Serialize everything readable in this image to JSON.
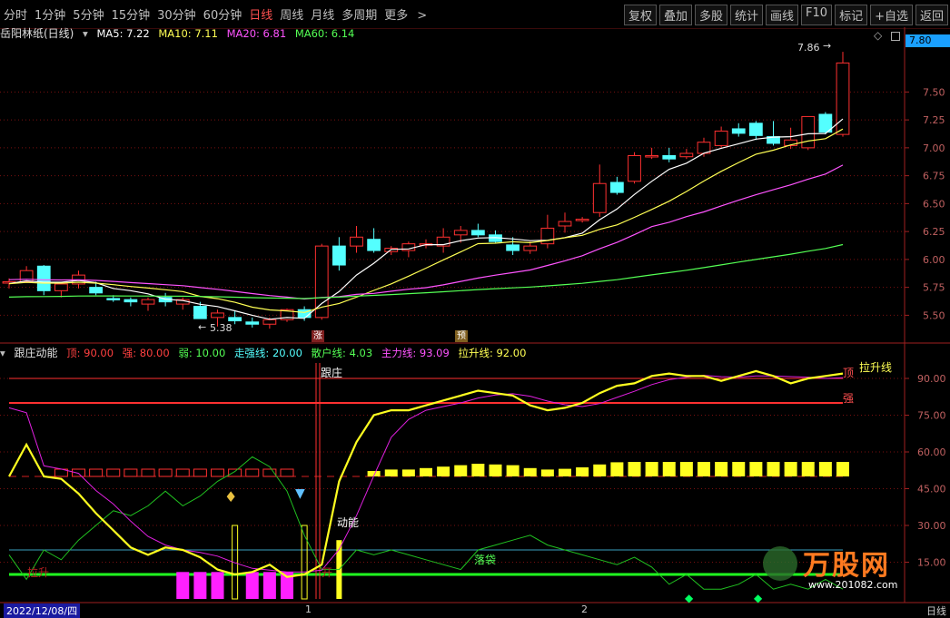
{
  "toolbar": {
    "periods": [
      "分时",
      "1分钟",
      "5分钟",
      "15分钟",
      "30分钟",
      "60分钟",
      "日线",
      "周线",
      "月线",
      "多周期",
      "更多"
    ],
    "active_period": "日线",
    "more_icon": "chevron-right-icon",
    "buttons": [
      "复权",
      "叠加",
      "多股",
      "统计",
      "画线",
      "F10",
      "标记",
      "+自选",
      "返回"
    ]
  },
  "main_panel": {
    "stock_name": "岳阳林纸(日线)",
    "ma5_label": "MA5: 7.22",
    "ma10_label": "MA10: 7.11",
    "ma20_label": "MA20: 6.81",
    "ma60_label": "MA60: 6.14",
    "current_price": "7.80",
    "high_annotation": "7.86",
    "low_annotation": "5.38",
    "badge_zhang": "涨",
    "badge_yu": "预",
    "colors": {
      "up": "#ff3030",
      "down": "#54ffff",
      "ma5": "#ffffff",
      "ma10": "#ffff54",
      "ma20": "#ff54ff",
      "ma60": "#54ff54"
    }
  },
  "sub_panel": {
    "indicator_name": "跟庄动能",
    "ding_label": "顶: 90.00",
    "qiang_label": "强: 80.00",
    "ruo_label": "弱: 10.00",
    "zouqiang_label": "走强线: 20.00",
    "sanhu_label": "散户线: 4.03",
    "zhuli_label": "主力线: 93.09",
    "lasheng_label": "拉升线: 92.00",
    "annot_genzhuang": "跟庄",
    "annot_dongneng": "动能",
    "annot_ding": "顶",
    "annot_lasheng": "拉升线",
    "annot_qiang": "强",
    "annot_zhuodai": "落袋",
    "annot_lasheng_left": "拉升",
    "annot_left2": "开"
  },
  "x_axis": {
    "date_label": "2022/12/08/四",
    "tick1": "1",
    "tick2": "2",
    "period_label": "日线"
  },
  "watermark": {
    "brand": "万股网",
    "url": "www.201082.com"
  },
  "chart_data": [
    {
      "type": "candlestick",
      "title": "岳阳林纸(日线)",
      "ylim": [
        5.3,
        7.95
      ],
      "yticks": [
        5.5,
        5.75,
        6.0,
        6.25,
        6.5,
        6.75,
        7.0,
        7.25,
        7.5
      ],
      "candles": [
        [
          5.8,
          5.83,
          5.74,
          5.8
        ],
        [
          5.8,
          5.94,
          5.8,
          5.9
        ],
        [
          5.94,
          5.95,
          5.68,
          5.72
        ],
        [
          5.72,
          5.8,
          5.66,
          5.78
        ],
        [
          5.78,
          5.9,
          5.74,
          5.86
        ],
        [
          5.75,
          5.8,
          5.68,
          5.7
        ],
        [
          5.65,
          5.68,
          5.62,
          5.64
        ],
        [
          5.64,
          5.66,
          5.58,
          5.62
        ],
        [
          5.6,
          5.66,
          5.54,
          5.64
        ],
        [
          5.66,
          5.7,
          5.58,
          5.62
        ],
        [
          5.6,
          5.66,
          5.55,
          5.64
        ],
        [
          5.58,
          5.62,
          5.48,
          5.47
        ],
        [
          5.48,
          5.55,
          5.4,
          5.52
        ],
        [
          5.48,
          5.54,
          5.42,
          5.45
        ],
        [
          5.44,
          5.48,
          5.39,
          5.42
        ],
        [
          5.42,
          5.48,
          5.38,
          5.46
        ],
        [
          5.46,
          5.56,
          5.44,
          5.55
        ],
        [
          5.55,
          5.58,
          5.45,
          5.48
        ],
        [
          5.48,
          6.14,
          5.46,
          6.12
        ],
        [
          6.12,
          6.2,
          5.9,
          5.95
        ],
        [
          6.12,
          6.3,
          6.06,
          6.2
        ],
        [
          6.18,
          6.28,
          6.06,
          6.08
        ],
        [
          6.07,
          6.12,
          6.04,
          6.1
        ],
        [
          6.08,
          6.16,
          6.02,
          6.14
        ],
        [
          6.14,
          6.18,
          6.1,
          6.14
        ],
        [
          6.12,
          6.28,
          6.06,
          6.2
        ],
        [
          6.22,
          6.3,
          6.15,
          6.26
        ],
        [
          6.26,
          6.32,
          6.2,
          6.22
        ],
        [
          6.22,
          6.26,
          6.15,
          6.16
        ],
        [
          6.13,
          6.2,
          6.04,
          6.08
        ],
        [
          6.08,
          6.16,
          6.05,
          6.12
        ],
        [
          6.14,
          6.4,
          6.1,
          6.28
        ],
        [
          6.3,
          6.42,
          6.24,
          6.34
        ],
        [
          6.36,
          6.38,
          6.33,
          6.36
        ],
        [
          6.42,
          6.85,
          6.38,
          6.68
        ],
        [
          6.69,
          6.74,
          6.58,
          6.6
        ],
        [
          6.7,
          6.96,
          6.68,
          6.93
        ],
        [
          6.93,
          7.0,
          6.9,
          6.93
        ],
        [
          6.93,
          7.0,
          6.87,
          6.9
        ],
        [
          6.92,
          6.99,
          6.9,
          6.95
        ],
        [
          6.95,
          7.09,
          6.92,
          7.05
        ],
        [
          7.02,
          7.19,
          7.0,
          7.15
        ],
        [
          7.17,
          7.22,
          7.1,
          7.13
        ],
        [
          7.22,
          7.24,
          7.07,
          7.11
        ],
        [
          7.1,
          7.24,
          7.02,
          7.04
        ],
        [
          7.02,
          7.18,
          6.99,
          7.07
        ],
        [
          7.0,
          7.28,
          6.98,
          7.28
        ],
        [
          7.3,
          7.32,
          7.12,
          7.14
        ],
        [
          7.12,
          7.86,
          7.1,
          7.76
        ]
      ]
    },
    {
      "type": "line",
      "title": "跟庄动能",
      "ylim": [
        0,
        100
      ],
      "yticks": [
        15,
        30,
        45,
        60,
        75,
        90
      ],
      "series": [
        {
          "name": "主力线",
          "values": [
            50,
            63,
            50,
            49,
            43,
            35,
            28,
            21,
            18,
            21,
            20,
            17,
            12,
            10,
            11,
            14,
            9,
            10,
            14,
            48,
            64,
            75,
            77,
            77,
            79,
            81,
            83,
            85,
            84,
            83,
            79,
            77,
            78,
            80,
            84,
            87,
            88,
            91,
            92,
            91,
            91,
            89,
            91,
            93,
            91,
            88,
            90,
            91,
            92
          ]
        },
        {
          "name": "散户线",
          "values": [
            18,
            8,
            20,
            16,
            24,
            30,
            36,
            34,
            38,
            44,
            38,
            42,
            48,
            52,
            58,
            54,
            44,
            26,
            12,
            12,
            20,
            18,
            20,
            18,
            16,
            14,
            12,
            20,
            22,
            24,
            26,
            22,
            20,
            18,
            16,
            14,
            17,
            13,
            6,
            10,
            4,
            4,
            6,
            10,
            4,
            6,
            4,
            8,
            4
          ]
        }
      ]
    }
  ]
}
